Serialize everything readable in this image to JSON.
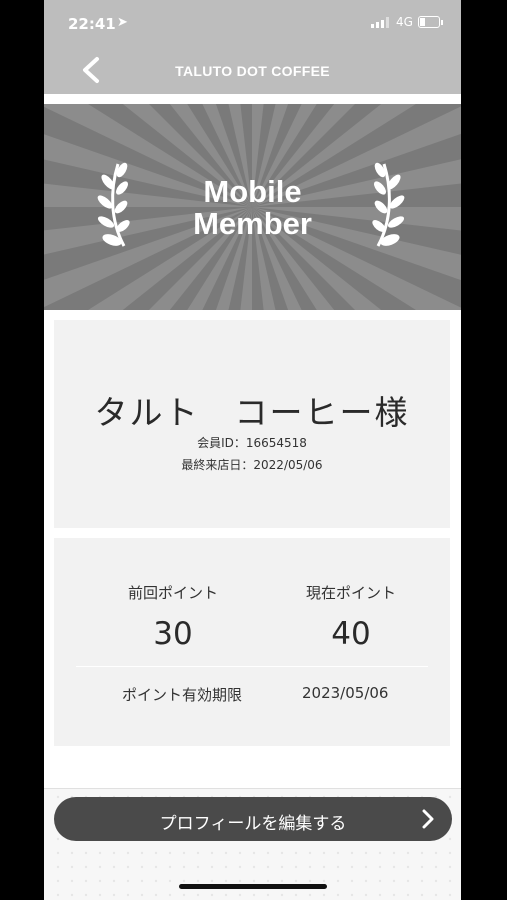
{
  "status_bar": {
    "time": "22:41",
    "network": "4G"
  },
  "header": {
    "title": "TALUTO DOT COFFEE"
  },
  "banner": {
    "line1": "Mobile",
    "line2": "Member"
  },
  "member": {
    "name": "タルト　コーヒー様",
    "member_id": "会員ID：16654518",
    "last_visit": "最終来店日：2022/05/06"
  },
  "points": {
    "previous_label": "前回ポイント",
    "previous_value": "30",
    "current_label": "現在ポイント",
    "current_value": "40",
    "expiry_label": "ポイント有効期限",
    "expiry_value": "2023/05/06"
  },
  "actions": {
    "edit_profile": "プロフィールを編集する"
  },
  "colors": {
    "banner": "#7a7a7a",
    "header": "#bdbdbd",
    "button": "#4a4a4a",
    "card": "#f2f2f2"
  }
}
